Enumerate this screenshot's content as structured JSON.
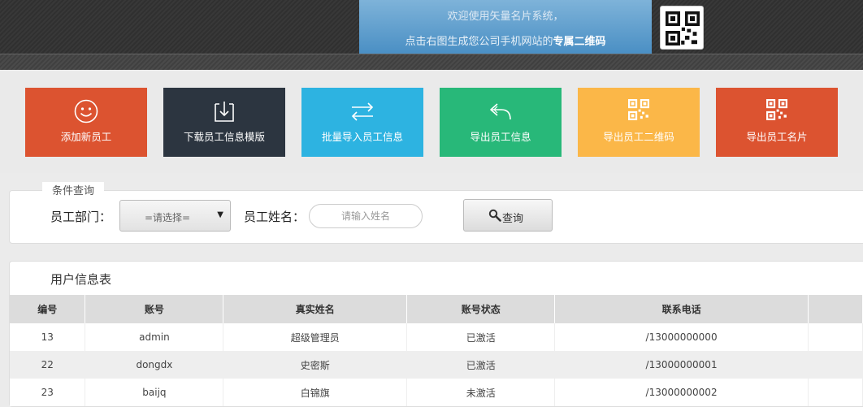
{
  "header": {
    "welcome_text": "欢迎使用矢量名片系统，",
    "qr_hint_prefix": "点击右图生成您公司手机网站的",
    "qr_hint_bold": "专属二维码",
    "qr_icon": "qr-code-icon"
  },
  "actions": [
    {
      "label": "添加新员工",
      "icon": "smile-icon",
      "color": "#dc5330"
    },
    {
      "label": "下载员工信息模版",
      "icon": "download-icon",
      "color": "#2c3540"
    },
    {
      "label": "批量导入员工信息",
      "icon": "swap-arrows-icon",
      "color": "#2db3e1"
    },
    {
      "label": "导出员工信息",
      "icon": "reply-arrow-icon",
      "color": "#28b879"
    },
    {
      "label": "导出员工二维码",
      "icon": "qr-code-icon",
      "color": "#fbb748"
    },
    {
      "label": "导出员工名片",
      "icon": "qr-code-icon",
      "color": "#dc5330"
    }
  ],
  "query": {
    "legend": "条件查询",
    "dept_label": "员工部门：",
    "dept_selected": "=请选择=",
    "name_label": "员工姓名：",
    "name_placeholder": "请输入姓名",
    "search_label": "查询"
  },
  "table": {
    "title": "用户信息表",
    "columns": [
      "编号",
      "账号",
      "真实姓名",
      "账号状态",
      "联系电话",
      ""
    ],
    "rows": [
      [
        "13",
        "admin",
        "超级管理员",
        "已激活",
        "/13000000000",
        ""
      ],
      [
        "22",
        "dongdx",
        "史密斯",
        "已激活",
        "/13000000001",
        ""
      ],
      [
        "23",
        "baijq",
        "白锦旗",
        "未激活",
        "/13000000002",
        ""
      ]
    ]
  }
}
